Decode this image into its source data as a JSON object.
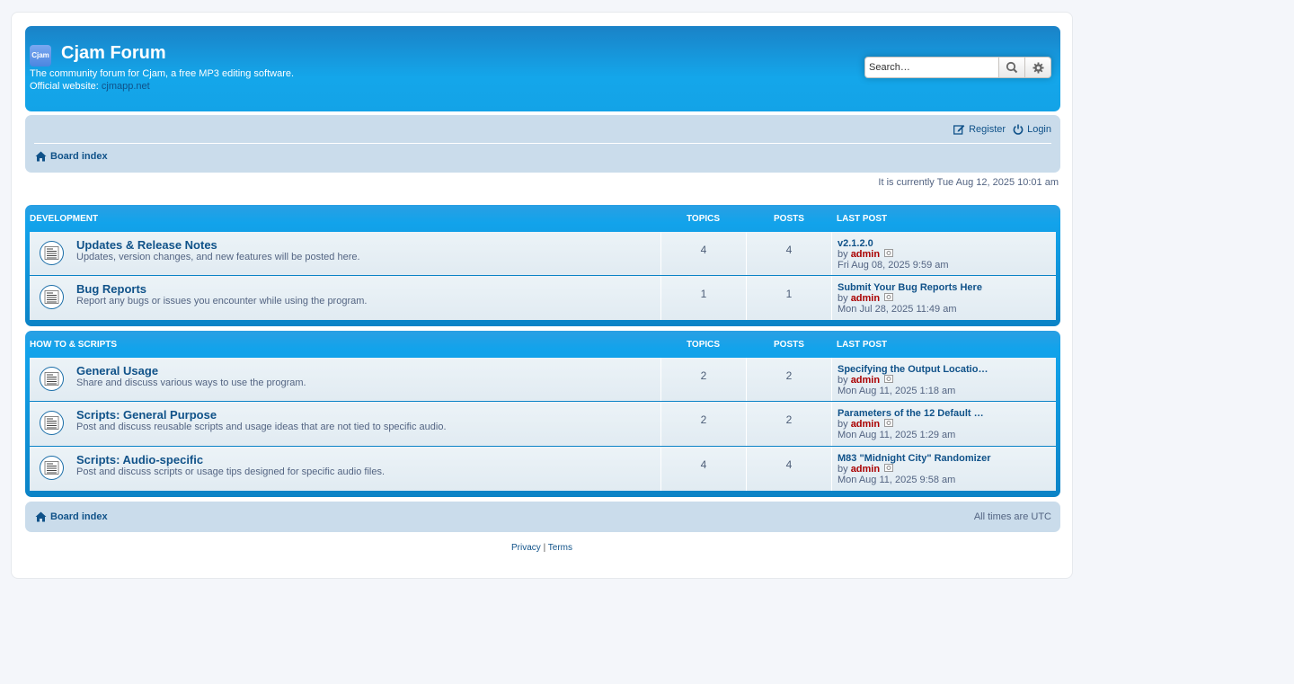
{
  "header": {
    "logo_text": "Cjam",
    "site_title": "Cjam Forum",
    "description": "The community forum for Cjam, a free MP3 editing software.",
    "website_label": "Official website:",
    "website_link": "cjmapp.net",
    "search_placeholder": "Search…",
    "colors": {
      "header_gradient_top": "#1a82c7",
      "header_gradient_bottom": "#13a3e7"
    }
  },
  "navbar": {
    "register": "Register",
    "login": "Login",
    "breadcrumb": "Board index"
  },
  "current_time": "It is currently Tue Aug 12, 2025 10:01 am",
  "categories": [
    {
      "title": "DEVELOPMENT",
      "col_topics": "TOPICS",
      "col_posts": "POSTS",
      "col_last": "LAST POST",
      "forums": [
        {
          "name": "Updates & Release Notes",
          "desc": "Updates, version changes, and new features will be posted here.",
          "topics": "4",
          "posts": "4",
          "last_title": "v2.1.2.0",
          "by": "by",
          "user": "admin",
          "date": "Fri Aug 08, 2025 9:59 am"
        },
        {
          "name": "Bug Reports",
          "desc": "Report any bugs or issues you encounter while using the program.",
          "topics": "1",
          "posts": "1",
          "last_title": "Submit Your Bug Reports Here",
          "by": "by",
          "user": "admin",
          "date": "Mon Jul 28, 2025 11:49 am"
        }
      ]
    },
    {
      "title": "HOW TO & SCRIPTS",
      "col_topics": "TOPICS",
      "col_posts": "POSTS",
      "col_last": "LAST POST",
      "forums": [
        {
          "name": "General Usage",
          "desc": "Share and discuss various ways to use the program.",
          "topics": "2",
          "posts": "2",
          "last_title": "Specifying the Output Locatio…",
          "by": "by",
          "user": "admin",
          "date": "Mon Aug 11, 2025 1:18 am"
        },
        {
          "name": "Scripts: General Purpose",
          "desc": "Post and discuss reusable scripts and usage ideas that are not tied to specific audio.",
          "topics": "2",
          "posts": "2",
          "last_title": "Parameters of the 12 Default …",
          "by": "by",
          "user": "admin",
          "date": "Mon Aug 11, 2025 1:29 am"
        },
        {
          "name": "Scripts: Audio-specific",
          "desc": "Post and discuss scripts or usage tips designed for specific audio files.",
          "topics": "4",
          "posts": "4",
          "last_title": "M83 \"Midnight City\" Randomizer",
          "by": "by",
          "user": "admin",
          "date": "Mon Aug 11, 2025 9:58 am"
        }
      ]
    }
  ],
  "footer": {
    "breadcrumb": "Board index",
    "timezone": "All times are UTC",
    "privacy": "Privacy",
    "separator": "|",
    "terms": "Terms"
  }
}
